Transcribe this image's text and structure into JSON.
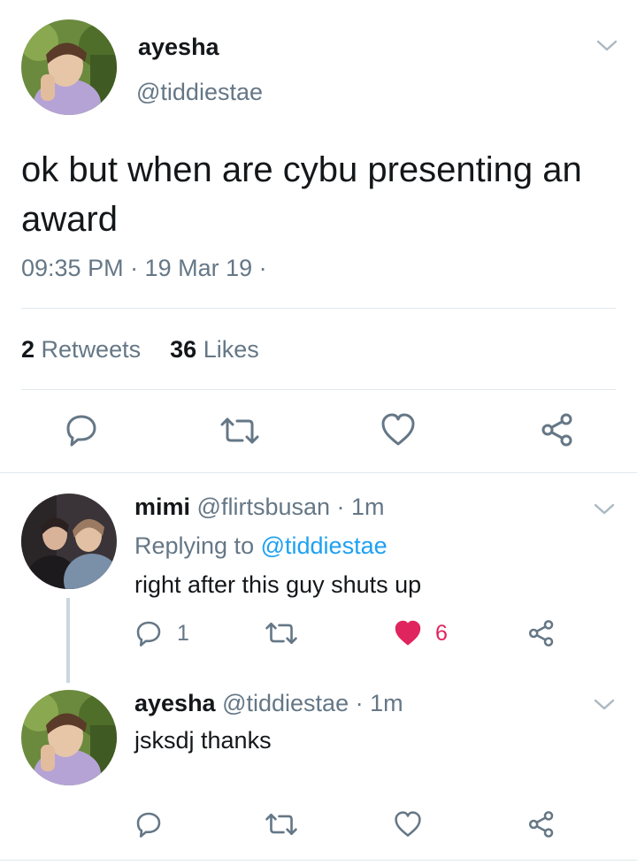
{
  "main_tweet": {
    "display_name": "ayesha",
    "handle": "@tiddiestae",
    "text": "ok but when are cybu presenting an award",
    "timestamp": "09:35 PM · 19 Mar 19 ·",
    "retweet_count": "2",
    "retweet_label": "Retweets",
    "like_count": "36",
    "like_label": "Likes"
  },
  "reply_1": {
    "display_name": "mimi",
    "handle": "@flirtsbusan",
    "time": "· 1m",
    "replying_prefix": "Replying to",
    "replying_handle": "@tiddiestae",
    "text": "right after this guy shuts up",
    "reply_count": "1",
    "like_count": "6",
    "liked": true
  },
  "reply_2": {
    "display_name": "ayesha",
    "handle": "@tiddiestae",
    "time": "· 1m",
    "text": "jsksdj thanks"
  },
  "colors": {
    "text": "#14171a",
    "secondary": "#657786",
    "link": "#1da1f2",
    "like_active": "#e0245e",
    "divider": "#e1e8ed"
  },
  "icons": [
    "reply-icon",
    "retweet-icon",
    "like-icon",
    "share-icon",
    "chevron-down-icon"
  ]
}
